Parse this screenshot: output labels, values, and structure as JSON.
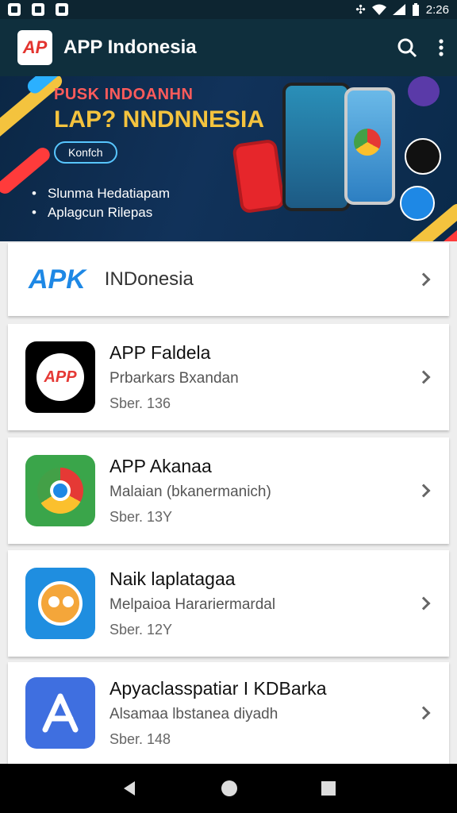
{
  "status_bar": {
    "time": "2:26"
  },
  "app_bar": {
    "logo_text": "AP",
    "title": "APP Indonesia"
  },
  "banner": {
    "line1": "PUSK INDOANHN",
    "line2": "LAP? NNDNNESIA",
    "bubble": "Konfch",
    "bullets": [
      "Slunma Hedatiapam",
      "Aplagcun Rilepas"
    ]
  },
  "featured": {
    "logo_text": "APK",
    "label": "INDonesia"
  },
  "apps": [
    {
      "title": "APP Faldela",
      "subtitle": "Prbarkars Bxandan",
      "meta": "Sber. 136",
      "icon": "app-p-logo-icon",
      "color": "#000000"
    },
    {
      "title": "APP Akanaa",
      "subtitle": "Malaian (bkanermanich)",
      "meta": "Sber. 13Y",
      "icon": "chrome-logo-icon",
      "color": "#3aa54a"
    },
    {
      "title": "Naik laplatagaa",
      "subtitle": "Melpaioa Harariermardal",
      "meta": "Sber. 12Y",
      "icon": "bird-face-icon",
      "color": "#1f8ee0"
    },
    {
      "title": "Apyaclasspatiar I KDBarka",
      "subtitle": "Alsamaa lbstanea diyadh",
      "meta": "Sber. 148",
      "icon": "app-store-a-icon",
      "color": "#3f6fe0"
    }
  ]
}
